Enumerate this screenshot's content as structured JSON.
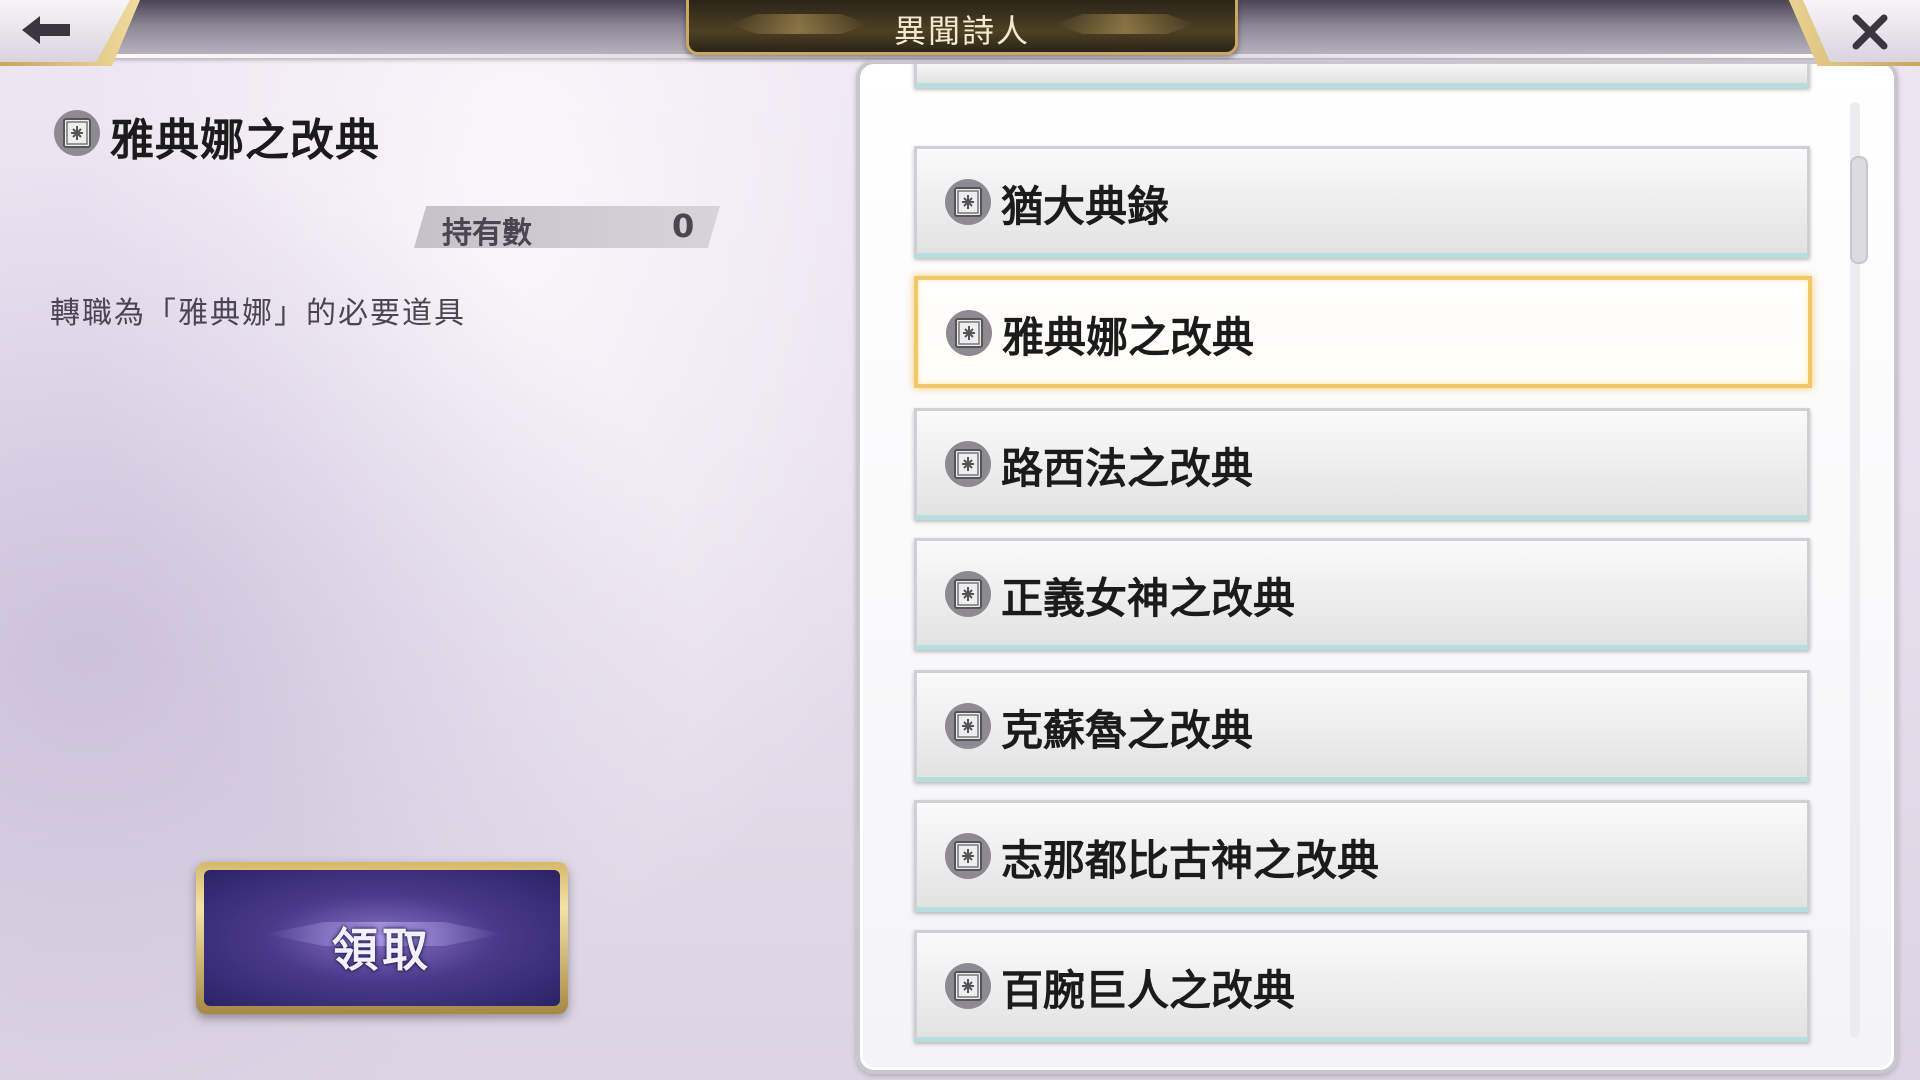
{
  "header": {
    "title": "異聞詩人",
    "back_icon": "arrow-left-icon",
    "close_icon": "close-icon"
  },
  "detail": {
    "icon": "book-icon",
    "name": "雅典娜之改典",
    "owned_label": "持有數",
    "owned_value": "0",
    "description": "轉職為「雅典娜」的必要道具",
    "claim_label": "領取"
  },
  "list": {
    "items": [
      {
        "label": "猶大典錄",
        "icon": "book-icon",
        "selected": false
      },
      {
        "label": "雅典娜之改典",
        "icon": "book-icon",
        "selected": true
      },
      {
        "label": "路西法之改典",
        "icon": "book-icon",
        "selected": false
      },
      {
        "label": "正義女神之改典",
        "icon": "book-icon",
        "selected": false
      },
      {
        "label": "克蘇魯之改典",
        "icon": "book-icon",
        "selected": false
      },
      {
        "label": "志那都比古神之改典",
        "icon": "book-icon",
        "selected": false
      },
      {
        "label": "百腕巨人之改典",
        "icon": "book-icon",
        "selected": false
      }
    ]
  },
  "colors": {
    "accent_gold": "#f0c868",
    "claim_purple": "#4a3a8a",
    "title_plate": "#2a2418"
  }
}
